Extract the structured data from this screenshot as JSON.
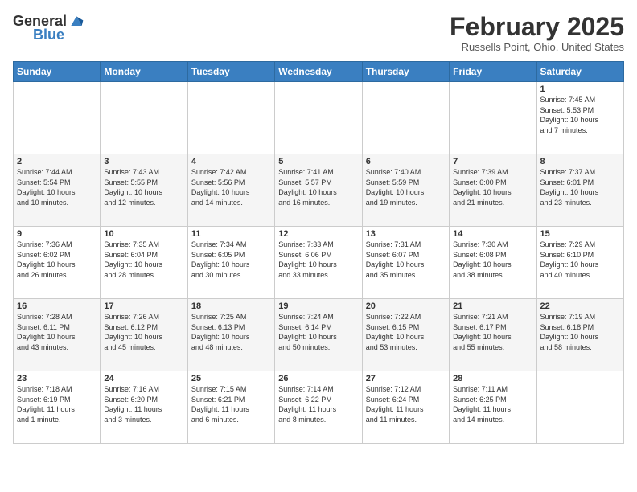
{
  "header": {
    "logo_general": "General",
    "logo_blue": "Blue",
    "month_title": "February 2025",
    "location": "Russells Point, Ohio, United States"
  },
  "weekdays": [
    "Sunday",
    "Monday",
    "Tuesday",
    "Wednesday",
    "Thursday",
    "Friday",
    "Saturday"
  ],
  "weeks": [
    [
      {
        "day": "",
        "info": ""
      },
      {
        "day": "",
        "info": ""
      },
      {
        "day": "",
        "info": ""
      },
      {
        "day": "",
        "info": ""
      },
      {
        "day": "",
        "info": ""
      },
      {
        "day": "",
        "info": ""
      },
      {
        "day": "1",
        "info": "Sunrise: 7:45 AM\nSunset: 5:53 PM\nDaylight: 10 hours\nand 7 minutes."
      }
    ],
    [
      {
        "day": "2",
        "info": "Sunrise: 7:44 AM\nSunset: 5:54 PM\nDaylight: 10 hours\nand 10 minutes."
      },
      {
        "day": "3",
        "info": "Sunrise: 7:43 AM\nSunset: 5:55 PM\nDaylight: 10 hours\nand 12 minutes."
      },
      {
        "day": "4",
        "info": "Sunrise: 7:42 AM\nSunset: 5:56 PM\nDaylight: 10 hours\nand 14 minutes."
      },
      {
        "day": "5",
        "info": "Sunrise: 7:41 AM\nSunset: 5:57 PM\nDaylight: 10 hours\nand 16 minutes."
      },
      {
        "day": "6",
        "info": "Sunrise: 7:40 AM\nSunset: 5:59 PM\nDaylight: 10 hours\nand 19 minutes."
      },
      {
        "day": "7",
        "info": "Sunrise: 7:39 AM\nSunset: 6:00 PM\nDaylight: 10 hours\nand 21 minutes."
      },
      {
        "day": "8",
        "info": "Sunrise: 7:37 AM\nSunset: 6:01 PM\nDaylight: 10 hours\nand 23 minutes."
      }
    ],
    [
      {
        "day": "9",
        "info": "Sunrise: 7:36 AM\nSunset: 6:02 PM\nDaylight: 10 hours\nand 26 minutes."
      },
      {
        "day": "10",
        "info": "Sunrise: 7:35 AM\nSunset: 6:04 PM\nDaylight: 10 hours\nand 28 minutes."
      },
      {
        "day": "11",
        "info": "Sunrise: 7:34 AM\nSunset: 6:05 PM\nDaylight: 10 hours\nand 30 minutes."
      },
      {
        "day": "12",
        "info": "Sunrise: 7:33 AM\nSunset: 6:06 PM\nDaylight: 10 hours\nand 33 minutes."
      },
      {
        "day": "13",
        "info": "Sunrise: 7:31 AM\nSunset: 6:07 PM\nDaylight: 10 hours\nand 35 minutes."
      },
      {
        "day": "14",
        "info": "Sunrise: 7:30 AM\nSunset: 6:08 PM\nDaylight: 10 hours\nand 38 minutes."
      },
      {
        "day": "15",
        "info": "Sunrise: 7:29 AM\nSunset: 6:10 PM\nDaylight: 10 hours\nand 40 minutes."
      }
    ],
    [
      {
        "day": "16",
        "info": "Sunrise: 7:28 AM\nSunset: 6:11 PM\nDaylight: 10 hours\nand 43 minutes."
      },
      {
        "day": "17",
        "info": "Sunrise: 7:26 AM\nSunset: 6:12 PM\nDaylight: 10 hours\nand 45 minutes."
      },
      {
        "day": "18",
        "info": "Sunrise: 7:25 AM\nSunset: 6:13 PM\nDaylight: 10 hours\nand 48 minutes."
      },
      {
        "day": "19",
        "info": "Sunrise: 7:24 AM\nSunset: 6:14 PM\nDaylight: 10 hours\nand 50 minutes."
      },
      {
        "day": "20",
        "info": "Sunrise: 7:22 AM\nSunset: 6:15 PM\nDaylight: 10 hours\nand 53 minutes."
      },
      {
        "day": "21",
        "info": "Sunrise: 7:21 AM\nSunset: 6:17 PM\nDaylight: 10 hours\nand 55 minutes."
      },
      {
        "day": "22",
        "info": "Sunrise: 7:19 AM\nSunset: 6:18 PM\nDaylight: 10 hours\nand 58 minutes."
      }
    ],
    [
      {
        "day": "23",
        "info": "Sunrise: 7:18 AM\nSunset: 6:19 PM\nDaylight: 11 hours\nand 1 minute."
      },
      {
        "day": "24",
        "info": "Sunrise: 7:16 AM\nSunset: 6:20 PM\nDaylight: 11 hours\nand 3 minutes."
      },
      {
        "day": "25",
        "info": "Sunrise: 7:15 AM\nSunset: 6:21 PM\nDaylight: 11 hours\nand 6 minutes."
      },
      {
        "day": "26",
        "info": "Sunrise: 7:14 AM\nSunset: 6:22 PM\nDaylight: 11 hours\nand 8 minutes."
      },
      {
        "day": "27",
        "info": "Sunrise: 7:12 AM\nSunset: 6:24 PM\nDaylight: 11 hours\nand 11 minutes."
      },
      {
        "day": "28",
        "info": "Sunrise: 7:11 AM\nSunset: 6:25 PM\nDaylight: 11 hours\nand 14 minutes."
      },
      {
        "day": "",
        "info": ""
      }
    ]
  ]
}
